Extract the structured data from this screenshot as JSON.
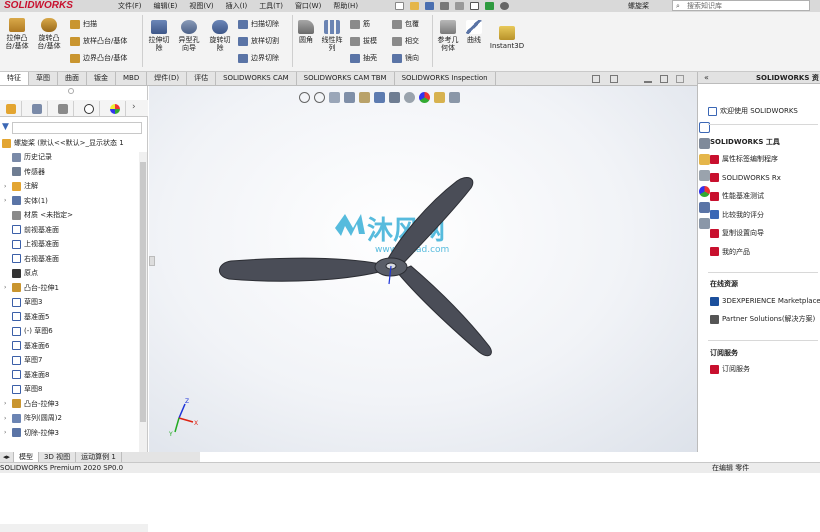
{
  "app": {
    "logo": "SOLIDWORKS",
    "document_title": "螺旋桨"
  },
  "menu": [
    "文件(F)",
    "编辑(E)",
    "视图(V)",
    "插入(I)",
    "工具(T)",
    "窗口(W)",
    "帮助(H)"
  ],
  "search": {
    "placeholder": "搜索知识库",
    "icon": "search-icon"
  },
  "ribbon": {
    "extrude_boss": "拉伸凸\n台/基体",
    "revolve_boss": "旋转凸\n台/基体",
    "sweep": "扫描",
    "loft": "放样凸台/基体",
    "boundary_boss": "边界凸台/基体",
    "extrude_cut": "拉伸切\n除",
    "hole_wizard": "异型孔\n向导",
    "revolve_cut": "旋转切\n除",
    "swept_cut": "扫描切除",
    "lofted_cut": "放样切割",
    "boundary_cut": "边界切除",
    "fillet": "圆角",
    "linear_pattern": "线性阵\n列",
    "rib": "筋",
    "draft": "拔模",
    "shell": "抽壳",
    "wrap": "包覆",
    "intersect": "相交",
    "mirror": "镜向",
    "ref_geometry": "参考几\n何体",
    "curves": "曲线",
    "instant3d": "Instant3D"
  },
  "tabs": [
    "特征",
    "草图",
    "曲面",
    "钣金",
    "MBD",
    "焊件(D)",
    "评估",
    "SOLIDWORKS CAM",
    "SOLIDWORKS CAM TBM",
    "SOLIDWORKS Inspection"
  ],
  "active_tab": "特征",
  "feature_tree": {
    "root": "螺旋桨  (默认<<默认>_显示状态 1",
    "items": [
      {
        "label": "历史记录",
        "icon": "history-icon",
        "arrow": ""
      },
      {
        "label": "传感器",
        "icon": "sensor-icon",
        "arrow": ""
      },
      {
        "label": "注解",
        "icon": "annotation-icon",
        "arrow": "›"
      },
      {
        "label": "实体(1)",
        "icon": "solid-bodies-icon",
        "arrow": "›"
      },
      {
        "label": "材质 <未指定>",
        "icon": "material-icon",
        "arrow": ""
      },
      {
        "label": "前视基准面",
        "icon": "plane-icon",
        "arrow": ""
      },
      {
        "label": "上视基准面",
        "icon": "plane-icon",
        "arrow": ""
      },
      {
        "label": "右视基准面",
        "icon": "plane-icon",
        "arrow": ""
      },
      {
        "label": "原点",
        "icon": "origin-icon",
        "arrow": ""
      },
      {
        "label": "凸台-拉伸1",
        "icon": "extrude-icon",
        "arrow": "›"
      },
      {
        "label": "草图3",
        "icon": "sketch-icon",
        "arrow": ""
      },
      {
        "label": "基准面5",
        "icon": "plane-icon",
        "arrow": ""
      },
      {
        "label": "(-) 草图6",
        "icon": "sketch-icon",
        "arrow": ""
      },
      {
        "label": "基准面6",
        "icon": "plane-icon",
        "arrow": ""
      },
      {
        "label": "草图7",
        "icon": "sketch-icon",
        "arrow": ""
      },
      {
        "label": "基准面8",
        "icon": "plane-icon",
        "arrow": ""
      },
      {
        "label": "草图8",
        "icon": "sketch-icon",
        "arrow": ""
      },
      {
        "label": "凸台-拉伸3",
        "icon": "extrude-icon",
        "arrow": "›"
      },
      {
        "label": "阵列(圆周)2",
        "icon": "pattern-icon",
        "arrow": "›"
      },
      {
        "label": "切除-拉伸3",
        "icon": "cut-icon",
        "arrow": "›"
      }
    ]
  },
  "viewport": {
    "watermark_main": "沐风网",
    "watermark_sub": "www.mfcad.com",
    "triad": {
      "x": "X",
      "y": "Y",
      "z": "Z"
    }
  },
  "task_pane": {
    "title": "SOLIDWORKS 资",
    "collapse": "«",
    "welcome": "欢迎使用 SOLIDWORKS",
    "tools_header": "SOLIDWORKS 工具",
    "tools": [
      {
        "label": "属性标签编制程序",
        "icon": "property-tab-icon"
      },
      {
        "label": "SOLIDWORKS Rx",
        "icon": "rx-icon"
      },
      {
        "label": "性能基准测试",
        "icon": "benchmark-icon"
      },
      {
        "label": "比较我的评分",
        "icon": "compare-score-icon"
      },
      {
        "label": "复制设置向导",
        "icon": "copy-settings-icon"
      },
      {
        "label": "我的产品",
        "icon": "my-products-icon"
      }
    ],
    "online_header": "在线资源",
    "online": [
      {
        "label": "3DEXPERIENCE Marketplace",
        "icon": "marketplace-icon"
      },
      {
        "label": "Partner Solutions(解决方案)",
        "icon": "partner-icon"
      }
    ],
    "sub_header": "订阅服务",
    "sub": [
      {
        "label": "订阅服务",
        "icon": "subscription-icon"
      }
    ]
  },
  "bottom_tabs": [
    "模型",
    "3D 视图",
    "运动算例 1"
  ],
  "status": {
    "left": "SOLIDWORKS Premium 2020 SP0.0",
    "right": "在编辑 零件"
  },
  "colors": {
    "brand": "#c8102e",
    "blade": "#4a4d57",
    "blade_edge": "#2c2e34",
    "watermark": "#3ab0d8"
  }
}
